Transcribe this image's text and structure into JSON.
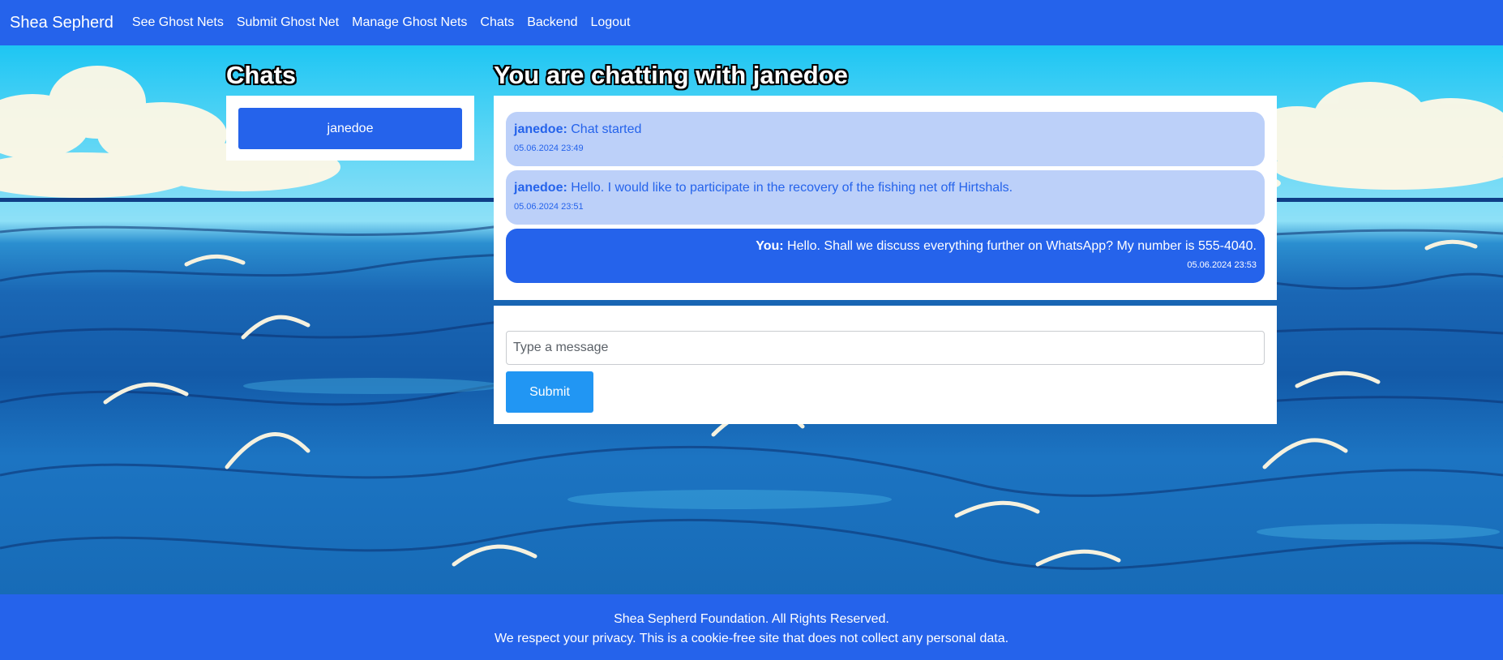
{
  "nav": {
    "brand": "Shea Sepherd",
    "links": [
      "See Ghost Nets",
      "Submit Ghost Net",
      "Manage Ghost Nets",
      "Chats",
      "Backend",
      "Logout"
    ]
  },
  "sidebar": {
    "title": "Chats",
    "chats": [
      "janedoe"
    ]
  },
  "conversation": {
    "title": "You are chatting with janedoe",
    "messages": [
      {
        "author": "janedoe:",
        "text": "Chat started",
        "time": "05.06.2024 23:49",
        "direction": "in"
      },
      {
        "author": "janedoe:",
        "text": "Hello. I would like to participate in the recovery of the fishing net off Hirtshals.",
        "time": "05.06.2024 23:51",
        "direction": "in"
      },
      {
        "author": "You:",
        "text": "Hello. Shall we discuss everything further on WhatsApp? My number is 555-4040.",
        "time": "05.06.2024 23:53",
        "direction": "out"
      }
    ]
  },
  "composer": {
    "placeholder": "Type a message",
    "value": "",
    "submit_label": "Submit"
  },
  "footer": {
    "line1": "Shea Sepherd Foundation. All Rights Reserved.",
    "line2": "We respect your privacy. This is a cookie-free site that does not collect any personal data."
  },
  "colors": {
    "primary": "#2563eb",
    "incoming_bubble": "#bcd0f9",
    "submit": "#2196f3",
    "panel": "#ffffff"
  }
}
